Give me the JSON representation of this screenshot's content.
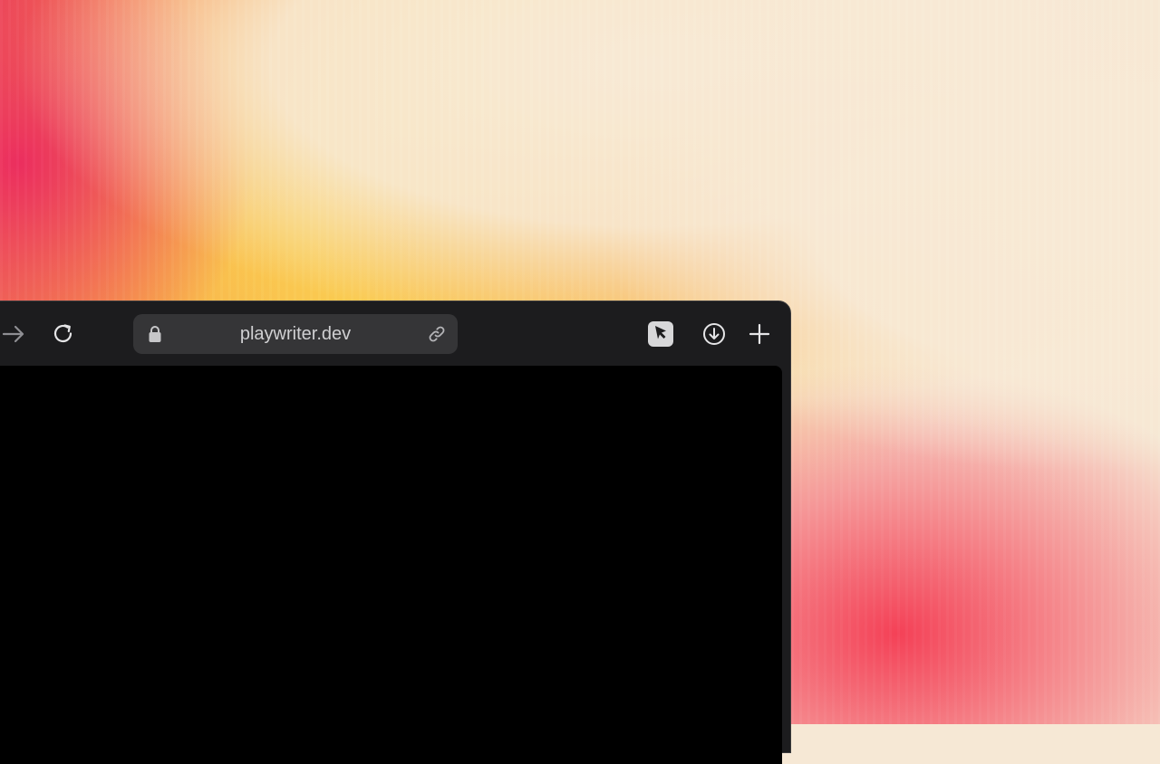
{
  "browser": {
    "url": "playwriter.dev"
  },
  "icons": {
    "forward": "arrow-right-icon",
    "reload": "reload-icon",
    "lock": "lock-icon",
    "copy_link": "link-icon",
    "extension": "cursor-arrow-icon",
    "downloads": "download-circle-icon",
    "new_tab": "plus-icon"
  }
}
